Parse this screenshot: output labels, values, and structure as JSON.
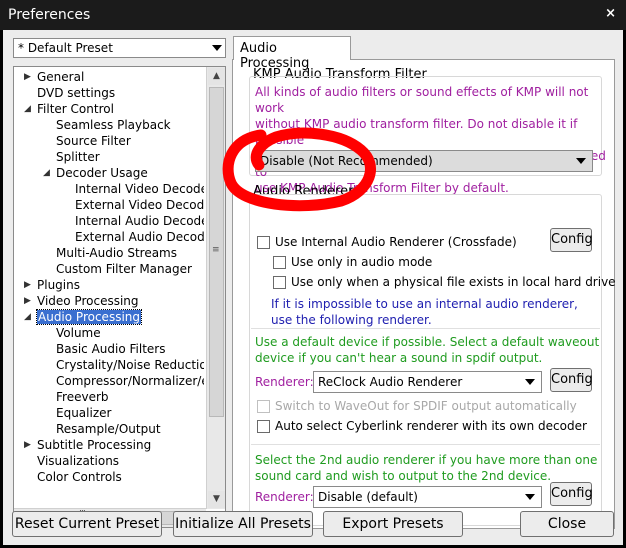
{
  "window": {
    "title": "Preferences",
    "close_glyph": "×"
  },
  "preset": {
    "selected": "* Default Preset"
  },
  "tree": {
    "items": [
      {
        "label": "General",
        "expander": "▶"
      },
      {
        "label": "DVD settings",
        "expander": ""
      },
      {
        "label": "Filter Control",
        "expander": "◢"
      },
      {
        "label": "Seamless Playback",
        "expander": ""
      },
      {
        "label": "Source Filter",
        "expander": ""
      },
      {
        "label": "Splitter",
        "expander": ""
      },
      {
        "label": "Decoder Usage",
        "expander": "◢"
      },
      {
        "label": "Internal Video Decoder",
        "expander": ""
      },
      {
        "label": "External Video Decoder",
        "expander": ""
      },
      {
        "label": "Internal Audio Decoder",
        "expander": ""
      },
      {
        "label": "External Audio Decoder",
        "expander": ""
      },
      {
        "label": "Multi-Audio Streams",
        "expander": ""
      },
      {
        "label": "Custom Filter Manager",
        "expander": ""
      },
      {
        "label": "Plugins",
        "expander": "▶"
      },
      {
        "label": "Video Processing",
        "expander": "▶"
      },
      {
        "label": "Audio Processing",
        "expander": "◢"
      },
      {
        "label": "Volume",
        "expander": ""
      },
      {
        "label": "Basic Audio Filters",
        "expander": ""
      },
      {
        "label": "Crystality/Noise Reduction",
        "expander": ""
      },
      {
        "label": "Compressor/Normalizer/etc",
        "expander": ""
      },
      {
        "label": "Freeverb",
        "expander": ""
      },
      {
        "label": "Equalizer",
        "expander": ""
      },
      {
        "label": "Resample/Output",
        "expander": ""
      },
      {
        "label": "Subtitle Processing",
        "expander": "▶"
      },
      {
        "label": "Visualizations",
        "expander": ""
      },
      {
        "label": "Color Controls",
        "expander": ""
      }
    ],
    "selected_label": "Audio Processing"
  },
  "tab": {
    "label": "Audio Processing"
  },
  "kmp_filter": {
    "title": "KMP Audio Transform Filter",
    "desc_lines": [
      "All kinds of audio filters or sound effects of KMP will not work",
      "without KMP audio transform filter. Do not disable it if possible",
      "as it does not require much cpu usage. It is recommended to",
      "use KMP Audio Transform Filter by default."
    ],
    "combo_value": "Disable (Not Recommended)"
  },
  "audio_renderer": {
    "title": "Audio Renderer",
    "use_internal": "Use Internal Audio Renderer (Crossfade)",
    "config_label": "Config",
    "only_audio_mode": "Use only in audio mode",
    "only_physical": "Use only when a physical file exists in local hard drive",
    "note_lines": [
      "If it is impossible to use an internal audio renderer,",
      "use the following renderer."
    ]
  },
  "default_device": {
    "desc_lines": [
      "Use a default device if possible. Select a default waveout",
      "device if you can't hear a sound in spdif output."
    ],
    "renderer_label": "Renderer:",
    "renderer_value": "ReClock Audio Renderer",
    "config_label": "Config",
    "switch_waveout": "Switch to WaveOut for SPDIF output automatically",
    "auto_cyberlink": "Auto select Cyberlink renderer with its own decoder"
  },
  "second_device": {
    "desc_lines": [
      "Select the 2nd audio renderer if you have more than one",
      "sound card and wish to output to the 2nd device."
    ],
    "renderer_label": "Renderer:",
    "renderer_value": "Disable (default)",
    "config_label": "Config"
  },
  "buttons": {
    "reset": "Reset Current Preset",
    "initialize": "Initialize All Presets",
    "export": "Export Presets",
    "close": "Close"
  },
  "colors": {
    "purple_text": "#a020a0",
    "green_text": "#1f9b1f",
    "blue_text": "#2020b0",
    "selection": "#3a6fd0",
    "scribble": "#ff0000"
  }
}
